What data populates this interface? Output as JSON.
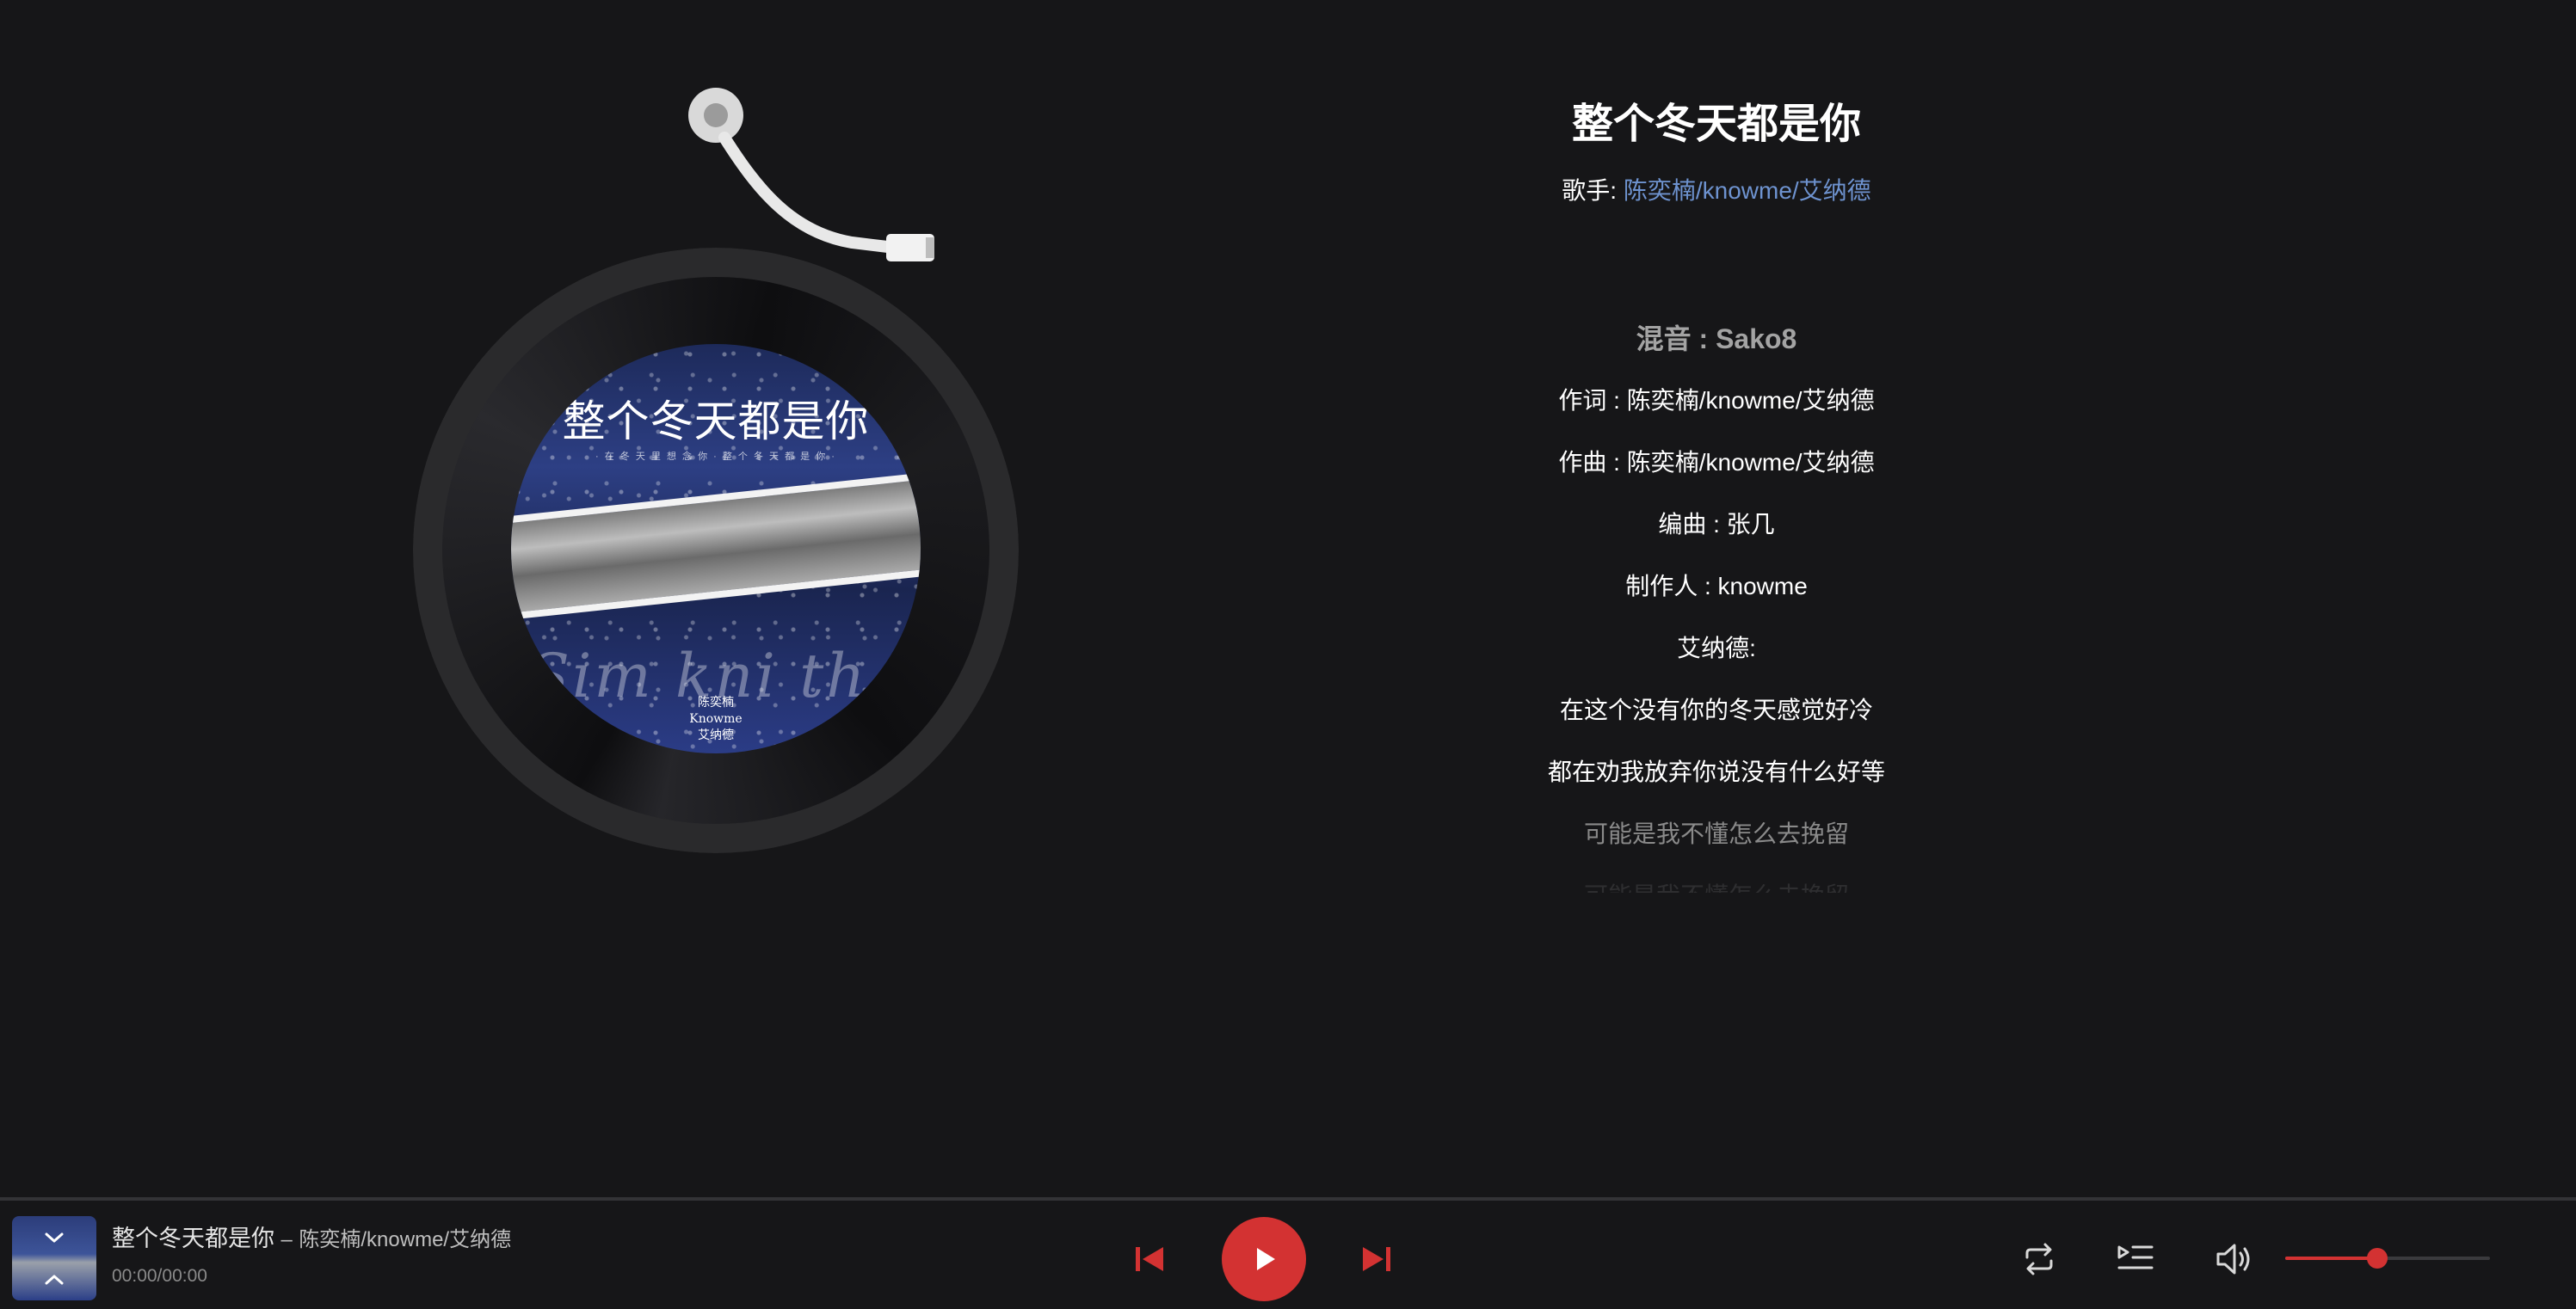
{
  "song": {
    "title": "整个冬天都是你",
    "artist_label": "歌手:",
    "artist": "陈奕楠/knowme/艾纳德"
  },
  "cover": {
    "title": "整个冬天都是你",
    "subtitle": "· 在 冬 天 里 想 念 你 · 整 个 冬 天 都 是 你 ·",
    "script": "Sim kni th",
    "artists": [
      "陈奕楠",
      "Knowme",
      "艾纳德"
    ]
  },
  "lyrics": [
    "混音 : Sako8",
    "作词 : 陈奕楠/knowme/艾纳德",
    "作曲 : 陈奕楠/knowme/艾纳德",
    "编曲 : 张几",
    "制作人 : knowme",
    "艾纳德:",
    "在这个没有你的冬天感觉好冷",
    "都在劝我放弃你说没有什么好等",
    "可能是我不懂怎么去挽留",
    "可能是我不懂怎么去挽留"
  ],
  "active_lyric_index": 0,
  "player": {
    "now_playing_title": "整个冬天都是你",
    "separator": "–",
    "now_playing_artist": "陈奕楠/knowme/艾纳德",
    "time": "00:00/00:00",
    "volume": 0.45,
    "accent_color": "#d33232",
    "link_color": "#6e93d0"
  },
  "icons": {
    "prev": "skip-previous-icon",
    "play": "play-icon",
    "next": "skip-next-icon",
    "repeat": "repeat-icon",
    "playlist": "playlist-icon",
    "volume": "volume-icon",
    "collapse": "chevron-down-icon",
    "expand": "chevron-up-icon"
  }
}
